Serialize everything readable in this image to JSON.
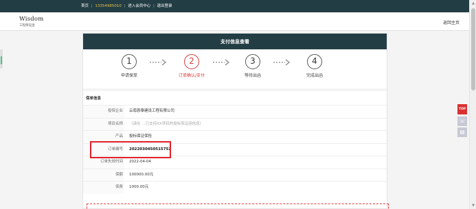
{
  "topbar": {
    "home": "首页",
    "phone": "13354985010",
    "member_center": "进入会员中心",
    "logout": "退出登录",
    "separator": "|"
  },
  "header": {
    "logo_main": "Wisdom",
    "logo_sub": "工程保证函",
    "home_link": "返回主页"
  },
  "card": {
    "title": "支付信息查看"
  },
  "steps": [
    {
      "number": "1",
      "label": "申请保单"
    },
    {
      "number": "2",
      "label": "订单确认/支付"
    },
    {
      "number": "3",
      "label": "等待出函"
    },
    {
      "number": "4",
      "label": "完成出函"
    }
  ],
  "active_step_number": "2",
  "section": {
    "title": "保单信息"
  },
  "info_rows": [
    {
      "label": "投保企业",
      "value": "云南恩泰建设工程有限公司"
    },
    {
      "label": "项目名称",
      "value": "（请在 …已支持XX项目的投标保证函信息）"
    },
    {
      "label": "产品",
      "value": "投标保证保险"
    },
    {
      "label": "订单编号",
      "value": "2022030450515752"
    },
    {
      "label": "订单失效时间",
      "value": "2022-04-04"
    },
    {
      "label": "保额",
      "value": "100000.00元"
    },
    {
      "label": "保费",
      "value": "1000.00元"
    }
  ],
  "side": {
    "top_label": "TOP",
    "icons": [
      "headset-icon",
      "document-icon"
    ]
  },
  "colors": {
    "topbar_bg": "#233d44",
    "accent_red": "#d73b3b",
    "phone_yellow": "#e6c24a",
    "highlight_red": "#e21f26"
  }
}
